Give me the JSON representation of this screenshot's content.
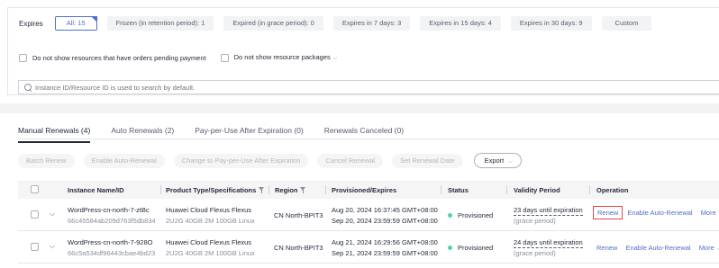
{
  "filters": {
    "expires_label": "Expires",
    "chips": [
      {
        "label": "All: 15",
        "active": true
      },
      {
        "label": "Frozen (in retention period): 1"
      },
      {
        "label": "Expired (in grace period): 0"
      },
      {
        "label": "Expires in 7 days: 3"
      },
      {
        "label": "Expires in 15 days: 4"
      },
      {
        "label": "Expires in 30 days: 9"
      },
      {
        "label": "Custom"
      }
    ],
    "check_pending": "Do not show resources that have orders pending payment",
    "check_packages": "Do not show resource packages",
    "search_placeholder": "Instance ID/Resource ID is used to search by default."
  },
  "tabs": [
    {
      "label": "Manual Renewals (4)",
      "active": true
    },
    {
      "label": "Auto Renewals (2)"
    },
    {
      "label": "Pay-per-Use After Expiration (0)"
    },
    {
      "label": "Renewals Canceled (0)"
    }
  ],
  "toolbar": {
    "batch_renew": "Batch Renew",
    "enable_auto_renewal": "Enable Auto-Renewal",
    "change_ppu": "Change to Pay-per-Use After Expiration",
    "cancel_renewal": "Cancel Renewal",
    "set_renewal_date": "Set Renewal Date",
    "export": "Export"
  },
  "table": {
    "headers": {
      "instance": "Instance Name/ID",
      "product": "Product Type/Specifications",
      "region": "Region",
      "provisioned": "Provisioned/Expires",
      "status": "Status",
      "validity": "Validity Period",
      "operation": "Operation"
    },
    "rows": [
      {
        "name": "WordPress-cn-north-7-ztBc",
        "id": "66c45584ab209d763f5db834",
        "product": "Huawei Cloud Flexus Flexus",
        "spec": "2U2G 40GB 2M 100GB Linux",
        "region": "CN North-BPIT3",
        "provisioned": "Aug 20, 2024 16:37:45 GMT+08:00",
        "expires": "Sep 20, 2024 23:59:59 GMT+08:00",
        "status": "Provisioned",
        "validity": "23 days until expiration",
        "validity_sub": "(grace period)",
        "op_renew": "Renew",
        "op_auto": "Enable Auto-Renewal",
        "op_more": "More",
        "highlight_renew": true
      },
      {
        "name": "WordPress-cn-north-7-928O",
        "id": "66c5a534df96443cbae4bd23",
        "product": "Huawei Cloud Flexus Flexus",
        "spec": "2U2G 40GB 2M 100GB Linux",
        "region": "CN North-BPIT3",
        "provisioned": "Aug 21, 2024 16:29:56 GMT+08:00",
        "expires": "Sep 21, 2024 23:59:59 GMT+08:00",
        "status": "Provisioned",
        "validity": "24 days until expiration",
        "validity_sub": "(grace period)",
        "op_renew": "Renew",
        "op_auto": "Enable Auto-Renewal",
        "op_more": "More",
        "highlight_renew": false
      }
    ]
  },
  "colors": {
    "accent": "#526ecc",
    "status_provisioned": "#50d4ab",
    "highlight": "#e54545"
  }
}
